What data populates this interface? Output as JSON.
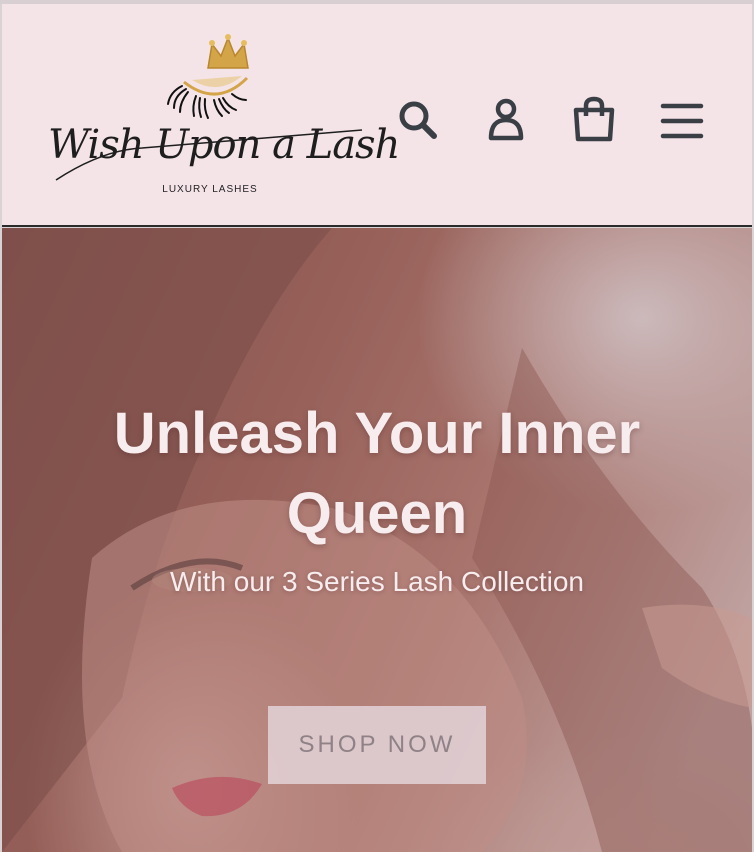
{
  "brand": {
    "name": "Wish Upon a Lash",
    "tagline": "LUXURY LASHES"
  },
  "header": {
    "icons": [
      "search-icon",
      "account-icon",
      "cart-icon",
      "menu-icon"
    ]
  },
  "hero": {
    "title": "Unleash Your Inner Queen",
    "subtitle": "With our 3 Series Lash Collection",
    "cta_label": "SHOP NOW"
  },
  "colors": {
    "header_bg": "#f4e4e8",
    "icon": "#3a3f46",
    "hero_text": "#f7ecee",
    "button_bg": "#e1d0d6",
    "button_text": "#8f8287"
  }
}
